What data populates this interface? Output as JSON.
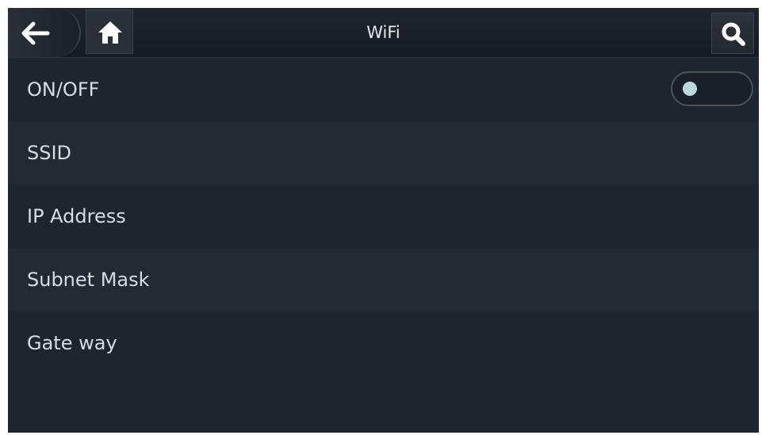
{
  "header": {
    "title": "WiFi",
    "back_icon": "arrow-left-icon",
    "home_icon": "home-icon",
    "search_icon": "search-icon"
  },
  "settings": {
    "items": [
      {
        "label": "ON/OFF",
        "control": "toggle",
        "value": "off"
      },
      {
        "label": "SSID"
      },
      {
        "label": "IP Address"
      },
      {
        "label": "Subnet Mask"
      },
      {
        "label": "Gate way"
      }
    ]
  },
  "colors": {
    "background": "#1f252d",
    "row_alt": "#242a31",
    "text": "#d9dcdf",
    "toggle_knob": "#b9d7dc"
  }
}
